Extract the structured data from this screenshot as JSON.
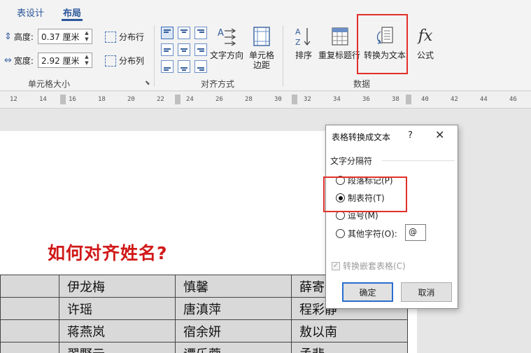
{
  "tabs": [
    {
      "label": "表设计"
    },
    {
      "label": "布局"
    }
  ],
  "cell_size": {
    "height_label": "高度:",
    "height_value": "0.37 厘米",
    "width_label": "宽度:",
    "width_value": "2.92 厘米",
    "distribute_rows": "分布行",
    "distribute_cols": "分布列",
    "group_label": "单元格大小"
  },
  "alignment": {
    "text_direction": "文字方向",
    "cell_margins_line1": "单元格",
    "cell_margins_line2": "边距",
    "group_label": "对齐方式"
  },
  "data_group": {
    "sort": "排序",
    "repeat_header": "重复标题行",
    "convert_to_text": "转换为文本",
    "formula": "公式",
    "group_label": "数据"
  },
  "ruler": {
    "labels": [
      "12",
      "14",
      "16",
      "18",
      "20",
      "22",
      "24",
      "26",
      "28",
      "30",
      "32",
      "34",
      "36",
      "38",
      "40",
      "42",
      "44",
      "46"
    ]
  },
  "document": {
    "title": "如何对齐姓名?",
    "rows": [
      [
        "",
        "伊龙梅",
        "慎馨",
        "薛寄"
      ],
      [
        "",
        "许瑶",
        "唐滇萍",
        "程彩静"
      ],
      [
        "",
        "蒋燕岚",
        "宿余妍",
        "敖以南"
      ],
      [
        "",
        "翠野云",
        "谭乐蓉",
        "孟斐"
      ]
    ]
  },
  "dialog": {
    "title": "表格转换成文本",
    "help": "?",
    "close": "✕",
    "section": "文字分隔符",
    "options": [
      {
        "label": "段落标记(P)",
        "selected": false
      },
      {
        "label": "制表符(T)",
        "selected": true
      },
      {
        "label": "逗号(M)",
        "selected": false
      },
      {
        "label": "其他字符(O):",
        "selected": false
      }
    ],
    "other_char": "@",
    "nested_tables": "转换嵌套表格(C)",
    "ok": "确定",
    "cancel": "取消"
  },
  "colors": {
    "accent": "#2b579a",
    "highlight": "#e0302a",
    "title_red": "#d01818"
  }
}
